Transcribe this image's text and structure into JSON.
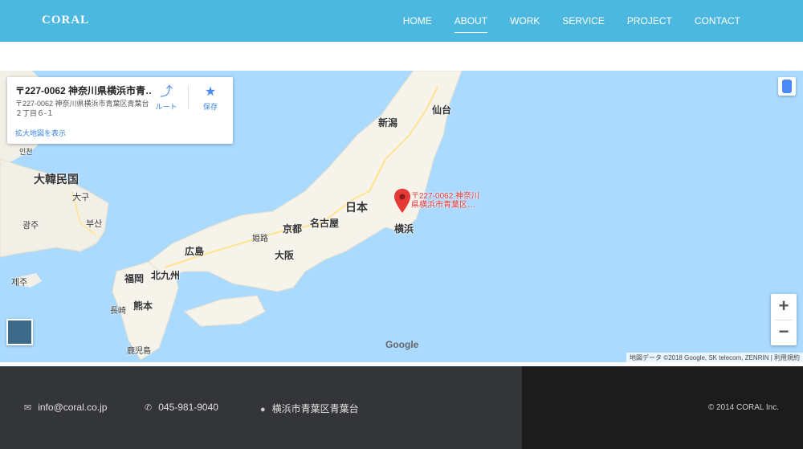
{
  "header": {
    "logo": "CORAL",
    "nav": [
      {
        "label": "HOME",
        "active": false
      },
      {
        "label": "ABOUT",
        "active": true
      },
      {
        "label": "WORK",
        "active": false
      },
      {
        "label": "SERVICE",
        "active": false
      },
      {
        "label": "PROJECT",
        "active": false
      },
      {
        "label": "CONTACT",
        "active": false
      }
    ]
  },
  "map": {
    "info": {
      "title": "〒227-0062 神奈川県横浜市青…",
      "address": "〒227-0062 神奈川県横浜市青葉区青葉台２丁目６-１",
      "route_label": "ルート",
      "save_label": "保存",
      "larger_map_label": "拡大地図を表示"
    },
    "pin_label": "〒227-0062 神奈川県横浜市青葉区…",
    "places": {
      "korea": "大韓民国",
      "daegu": "大구",
      "gwangju": "광주",
      "busan": "부산",
      "jeju": "제주",
      "incheon": "인천",
      "japan": "日本",
      "niigata": "新潟",
      "sendai": "仙台",
      "yokohama": "横浜",
      "nagoya": "名古屋",
      "kyoto": "京都",
      "osaka": "大阪",
      "himeji": "姫路",
      "hiroshima": "広島",
      "fukuoka": "福岡",
      "kitakyushu": "北九州",
      "nagasaki": "長崎",
      "kumamoto": "熊本",
      "kagoshima": "鹿児島"
    },
    "zoom_in": "+",
    "zoom_out": "−",
    "google": "Google",
    "credits": "地図データ ©2018 Google, SK telecom, ZENRIN  |  利用規約"
  },
  "footer": {
    "email": "info@coral.co.jp",
    "phone": "045-981-9040",
    "location": "横浜市青葉区青葉台",
    "copyright": "© 2014 CORAL Inc."
  }
}
